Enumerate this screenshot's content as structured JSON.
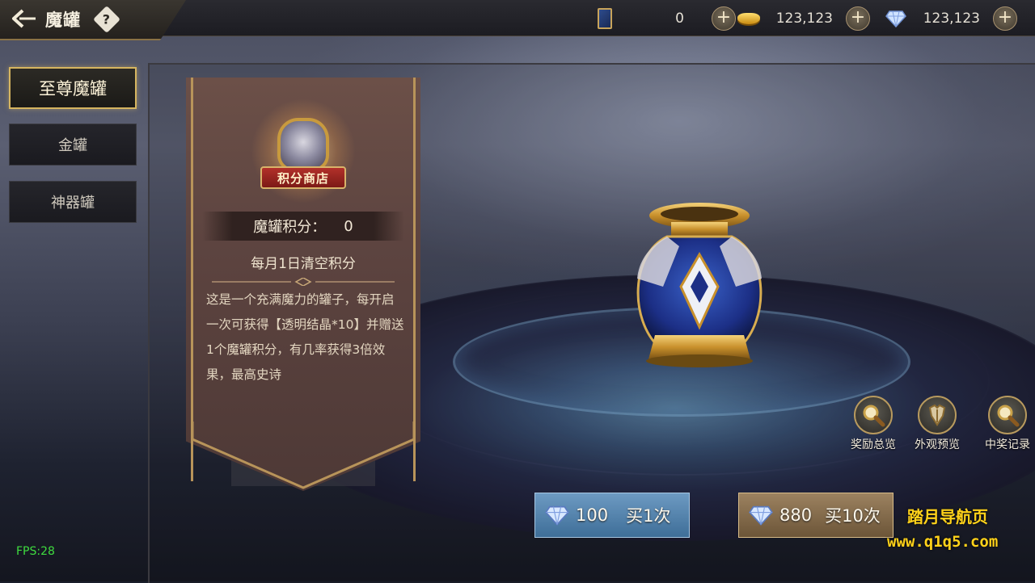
{
  "header": {
    "title": "魔罐",
    "help_icon": "question-icon",
    "back_icon": "back-arrow-icon"
  },
  "currencies": [
    {
      "icon": "ticket-icon",
      "value": "0"
    },
    {
      "icon": "gold-ingot-icon",
      "value": "123,123"
    },
    {
      "icon": "diamond-icon",
      "value": "123,123"
    }
  ],
  "tabs": [
    {
      "label": "至尊魔罐",
      "active": true
    },
    {
      "label": "金罐",
      "active": false
    },
    {
      "label": "神器罐",
      "active": false
    }
  ],
  "shop": {
    "emblem_label": "积分商店",
    "points_label": "魔罐积分：",
    "points_value": "0",
    "reset_note": "每月1日清空积分",
    "description": "这是一个充满魔力的罐子，每开启一次可获得【透明结晶*10】并赠送1个魔罐积分，有几率获得3倍效果，最高史诗"
  },
  "side_buttons": [
    {
      "label": "奖励总览",
      "icon": "magnifier-icon"
    },
    {
      "label": "外观预览",
      "icon": "armor-icon"
    },
    {
      "label": "中奖记录",
      "icon": "magnifier-icon"
    }
  ],
  "buy": {
    "one": {
      "cost": "100",
      "label": "买1次"
    },
    "ten": {
      "cost": "880",
      "label": "买10次"
    }
  },
  "watermark": {
    "name": "踏月导航页",
    "url": "www.q1q5.com"
  },
  "fps": "FPS:28",
  "colors": {
    "accent_gold": "#d6b560",
    "buy_one": "#4f80aa",
    "buy_ten": "#85694a",
    "watermark": "#ffd21a"
  }
}
